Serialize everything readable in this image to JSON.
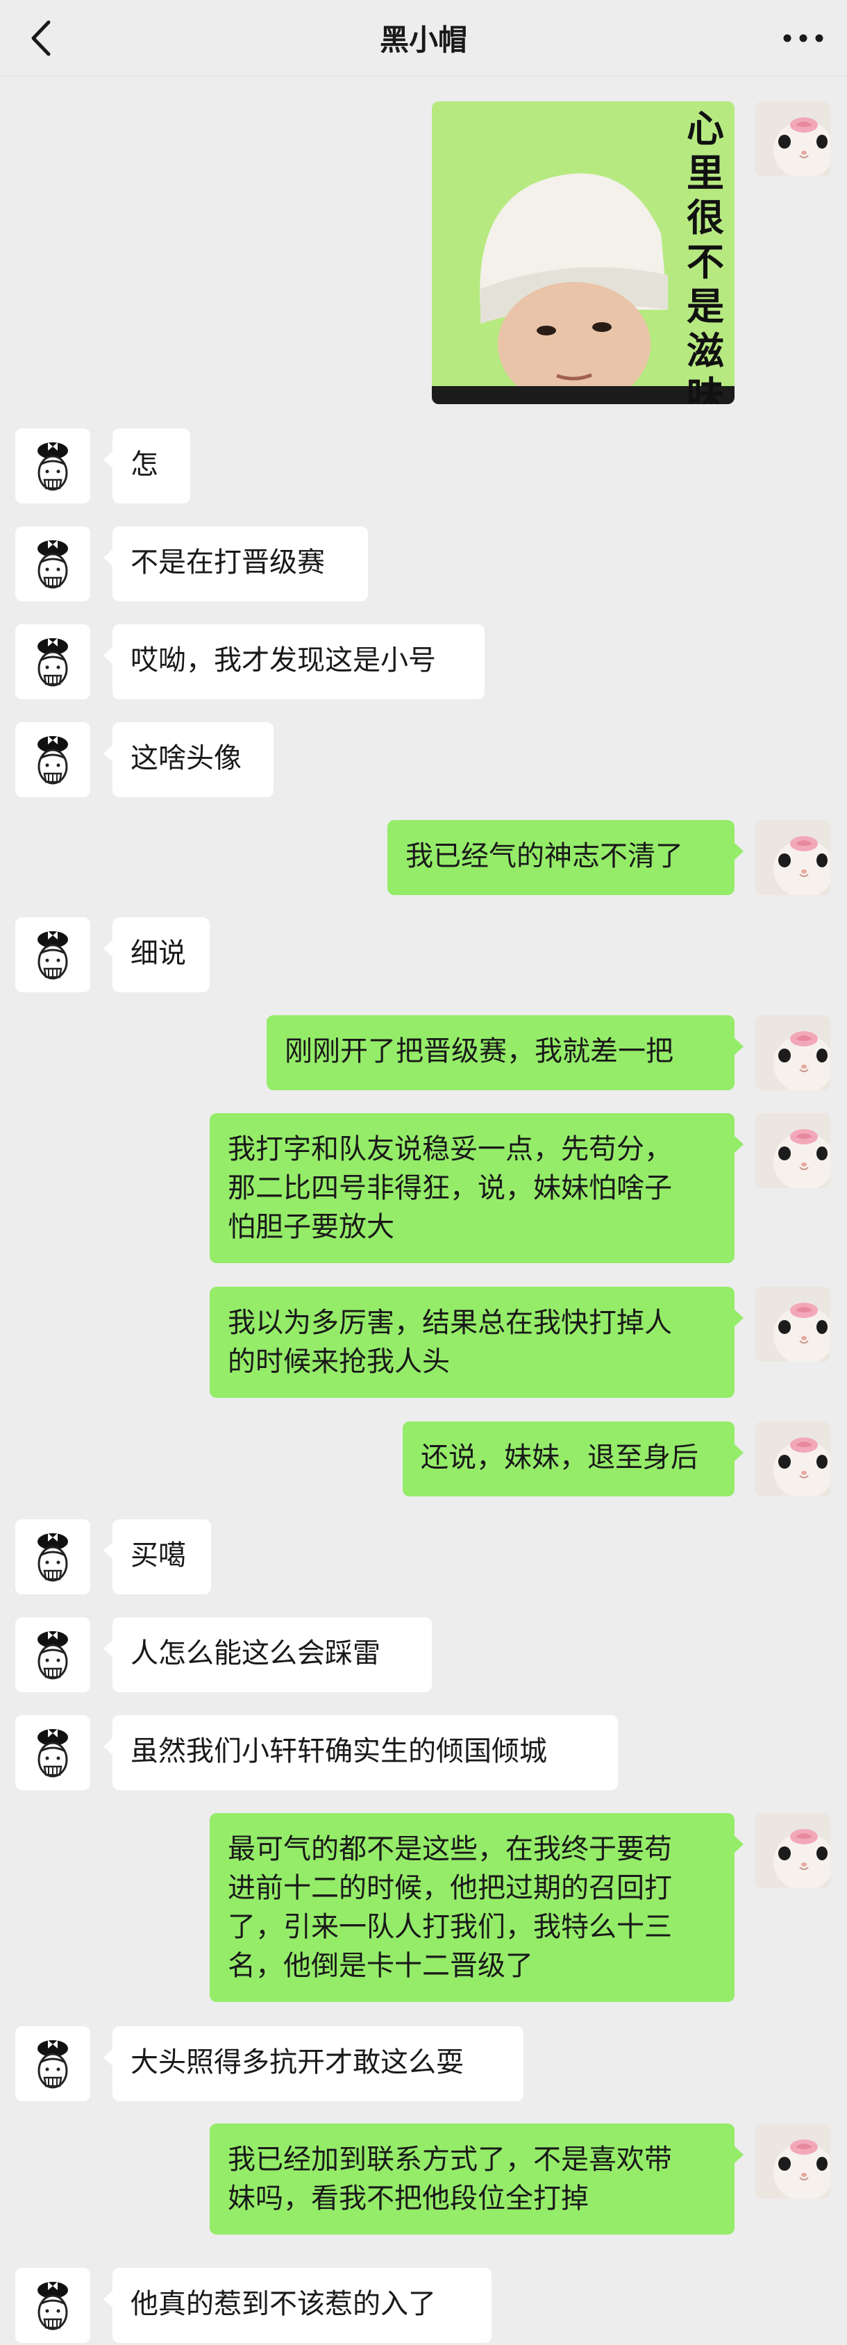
{
  "header": {
    "title": "黑小帽"
  },
  "messages": [
    {
      "side": "right",
      "type": "sticker",
      "caption": "心里很不是滋味"
    },
    {
      "side": "left",
      "text": "怎"
    },
    {
      "side": "left",
      "text": "不是在打晋级赛"
    },
    {
      "side": "left",
      "text": "哎呦，我才发现这是小号"
    },
    {
      "side": "left",
      "text": "这啥头像"
    },
    {
      "side": "right",
      "text": "我已经气的神志不清了"
    },
    {
      "side": "left",
      "text": "细说"
    },
    {
      "side": "right",
      "text": "刚刚开了把晋级赛，我就差一把"
    },
    {
      "side": "right",
      "text": "我打字和队友说稳妥一点，先苟分，\n那二比四号非得狂，说，妹妹怕啥子\n怕胆子要放大"
    },
    {
      "side": "right",
      "text": "我以为多厉害，结果总在我快打掉人\n的时候来抢我人头"
    },
    {
      "side": "right",
      "text": "还说，妹妹，退至身后"
    },
    {
      "side": "left",
      "text": "买噶"
    },
    {
      "side": "left",
      "text": "人怎么能这么会踩雷"
    },
    {
      "side": "left",
      "text": "虽然我们小轩轩确实生的倾国倾城"
    },
    {
      "side": "right",
      "text": "最可气的都不是这些，在我终于要苟\n进前十二的时候，他把过期的召回打\n了，引来一队人打我们，我特么十三\n名，他倒是卡十二晋级了"
    },
    {
      "side": "left",
      "text": "大头照得多抗开才敢这么耍"
    },
    {
      "side": "right",
      "text": "我已经加到联系方式了，不是喜欢带\n妹吗，看我不把他段位全打掉"
    },
    {
      "side": "left",
      "text": "他真的惹到不该惹的入了"
    }
  ]
}
